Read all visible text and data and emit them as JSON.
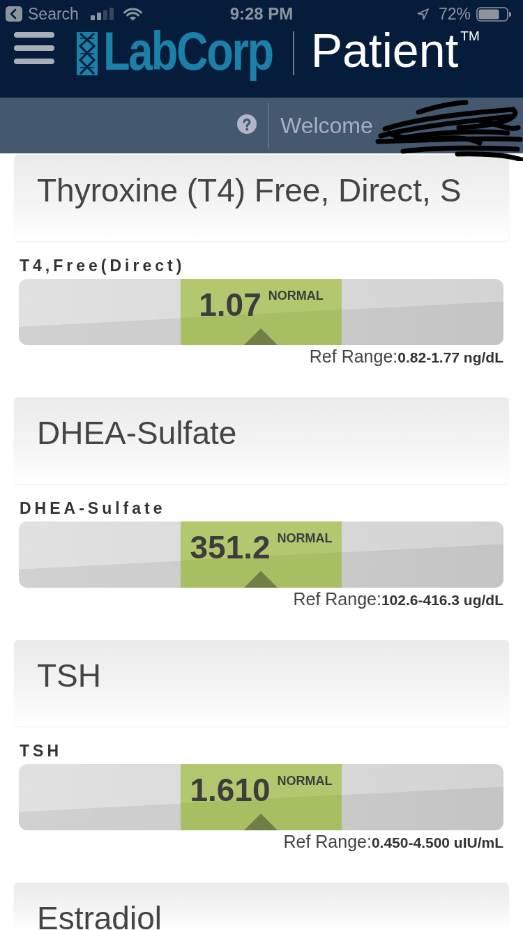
{
  "status_bar": {
    "back_label": "Search",
    "time": "9:28 PM",
    "battery": "72%"
  },
  "header": {
    "brand": "LabCorp",
    "product": "Patient$^{TM}$"
  },
  "subheader": {
    "greeting": "Welcome"
  },
  "results": [
    {
      "title": "Thyroxine (T4) Free, Direct, S",
      "tests": [
        {
          "name": "T4,Free(Direct)",
          "value": "1.07",
          "flag": "NORMAL",
          "kind": "normal",
          "reference": "Ref Range:**0.82-1.77 ng/dL**"
        }
      ]
    },
    {
      "title": "DHEA-Sulfate",
      "tests": [
        {
          "name": "DHEA-Sulfate",
          "value": "351.2",
          "flag": "NORMAL",
          "kind": "normal",
          "reference": "Ref Range:**102.6-416.3 ug/dL**"
        }
      ]
    },
    {
      "title": "TSH",
      "tests": [
        {
          "name": "TSH",
          "value": "1.610",
          "flag": "NORMAL",
          "kind": "normal",
          "reference": "Ref Range:**0.450-4.500 uIU/mL**"
        }
      ]
    },
    {
      "title": "Estradiol"
    }
  ]
}
